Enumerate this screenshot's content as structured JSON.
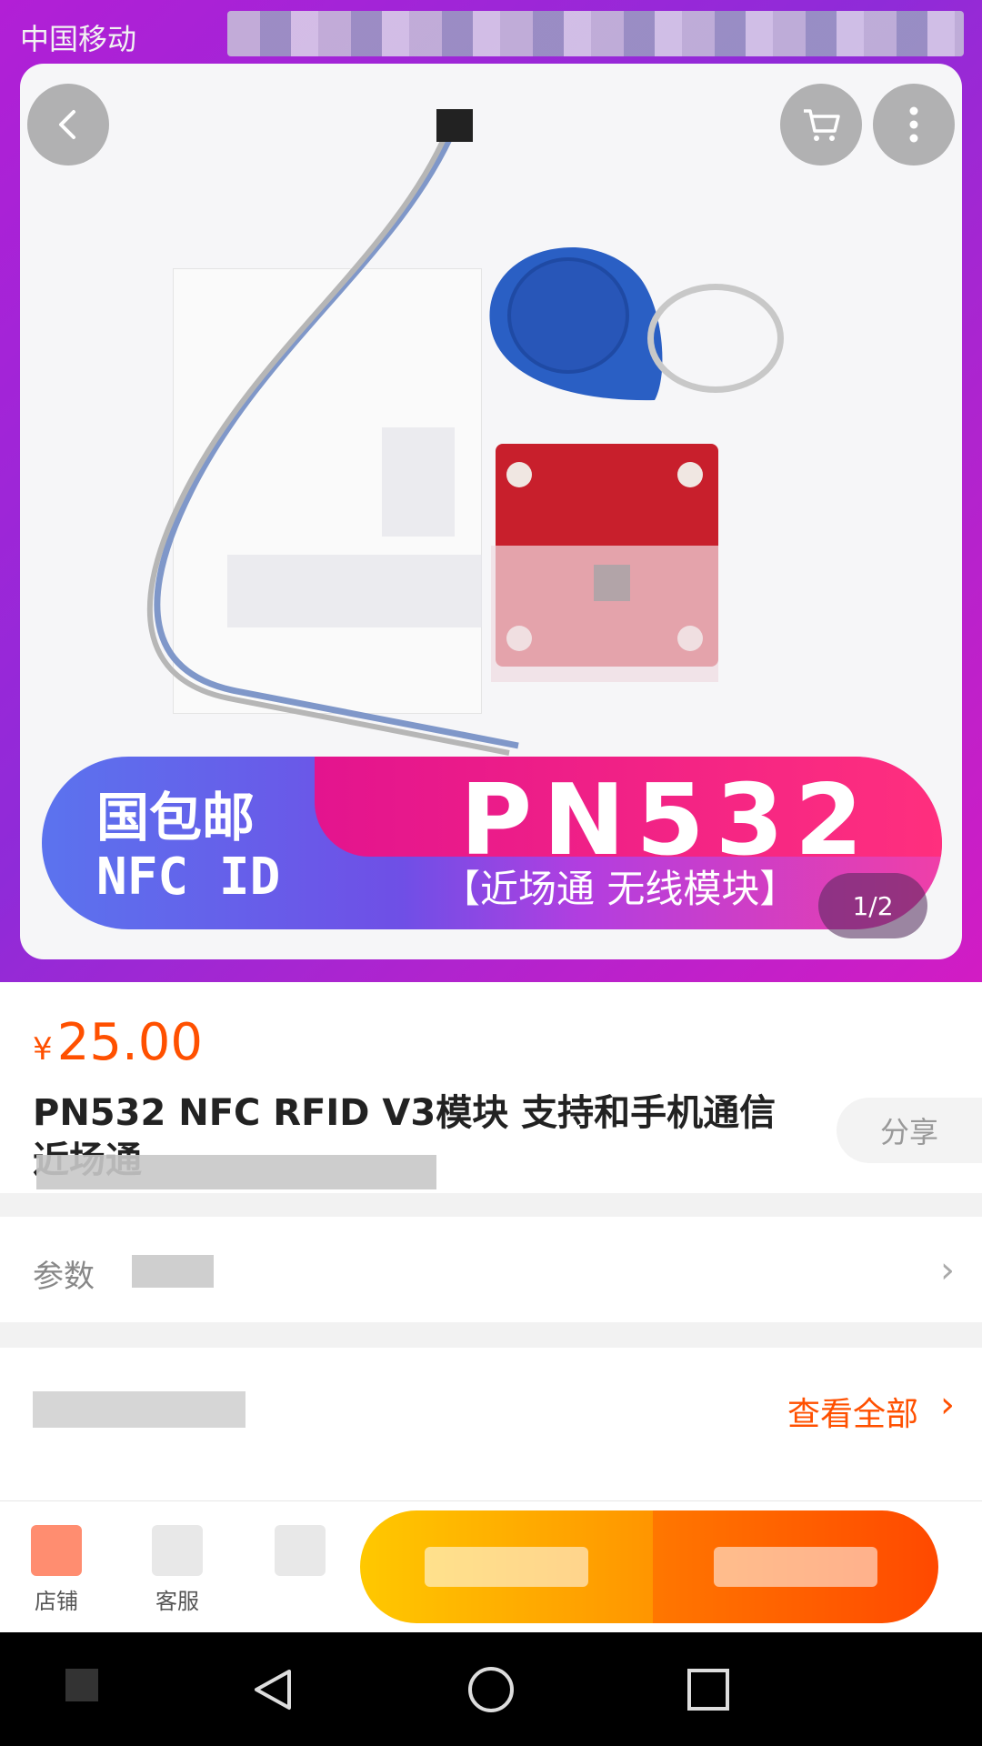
{
  "status_bar": {
    "carrier": "中国移动"
  },
  "hero": {
    "banner_left_line1": "国包邮",
    "banner_left_line2": "NFC  ID",
    "banner_big": "PN532",
    "banner_sub": "【近场通  无线模块】",
    "page_indicator": "1/2"
  },
  "icons": {
    "back": "back-arrow-icon",
    "cart": "cart-icon",
    "more": "more-vertical-icon"
  },
  "product": {
    "currency": "¥",
    "price": "25.00",
    "title": "PN532 NFC RFID V3模块          支持和手机通信 近场通",
    "share": "分享"
  },
  "params": {
    "label": "参数"
  },
  "reviews": {
    "view_all": "查看全部"
  },
  "action_bar": {
    "store_label": "店铺",
    "service_label": "客服",
    "fav_label": ""
  },
  "colors": {
    "accent": "#ff5000",
    "add_to_cart": "#ffa800",
    "buy_now": "#ff5a00"
  }
}
